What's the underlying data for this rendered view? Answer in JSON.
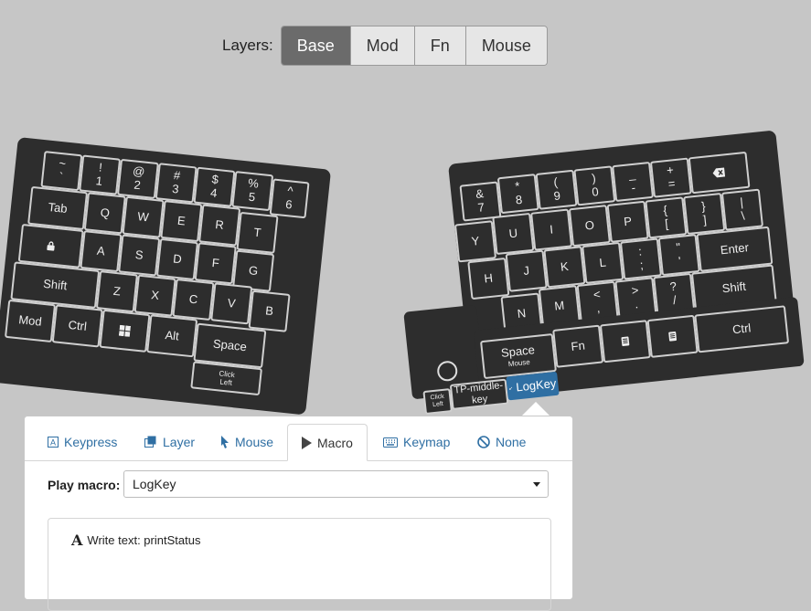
{
  "layers": {
    "label": "Layers:",
    "items": [
      {
        "label": "Base",
        "active": true
      },
      {
        "label": "Mod",
        "active": false
      },
      {
        "label": "Fn",
        "active": false
      },
      {
        "label": "Mouse",
        "active": false
      }
    ]
  },
  "left_keys": {
    "tilde": {
      "top": "~",
      "bottom": "`"
    },
    "k1": {
      "top": "!",
      "bottom": "1"
    },
    "k2": {
      "top": "@",
      "bottom": "2"
    },
    "k3": {
      "top": "#",
      "bottom": "3"
    },
    "k4": {
      "top": "$",
      "bottom": "4"
    },
    "k5": {
      "top": "%",
      "bottom": "5"
    },
    "k6": {
      "top": "^",
      "bottom": "6"
    },
    "tab": "Tab",
    "q": "Q",
    "w": "W",
    "e": "E",
    "r": "R",
    "t": "T",
    "a": "A",
    "s": "S",
    "d": "D",
    "f": "F",
    "g": "G",
    "shift": "Shift",
    "z": "Z",
    "x": "X",
    "c": "C",
    "v": "V",
    "b": "B",
    "mod": "Mod",
    "ctrl": "Ctrl",
    "alt": "Alt",
    "space": "Space",
    "click_left": {
      "top": "Click",
      "bottom": "Left"
    }
  },
  "right_keys": {
    "k7": {
      "top": "&",
      "bottom": "7"
    },
    "k8": {
      "top": "*",
      "bottom": "8"
    },
    "k9": {
      "top": "(",
      "bottom": "9"
    },
    "k0": {
      "top": ")",
      "bottom": "0"
    },
    "minus": {
      "top": "_",
      "bottom": "-"
    },
    "equal": {
      "top": "+",
      "bottom": "="
    },
    "y": "Y",
    "u": "U",
    "i": "I",
    "o": "O",
    "p": "P",
    "lbracket": {
      "top": "{",
      "bottom": "["
    },
    "rbracket": {
      "top": "}",
      "bottom": "]"
    },
    "pipe": {
      "top": "|",
      "bottom": "\\"
    },
    "h": "H",
    "j": "J",
    "k": "K",
    "l": "L",
    "semicolon": {
      "top": ":",
      "bottom": ";"
    },
    "quote": {
      "top": "\"",
      "bottom": "'"
    },
    "enter": "Enter",
    "n": "N",
    "m": "M",
    "comma": {
      "top": "<",
      "bottom": ","
    },
    "period": {
      "top": ">",
      "bottom": "."
    },
    "slash": {
      "top": "?",
      "bottom": "/"
    },
    "shift": "Shift",
    "space": "Space",
    "space_sub": "Mouse",
    "fn": "Fn",
    "ctrl": "Ctrl",
    "logkey": "LogKey",
    "click_left": {
      "top": "Click",
      "bottom": "Left"
    },
    "tp_middle": "TP-middle-key"
  },
  "panel": {
    "tabs": [
      {
        "label": "Keypress",
        "icon": "keypress-icon"
      },
      {
        "label": "Layer",
        "icon": "layer-icon"
      },
      {
        "label": "Mouse",
        "icon": "mouse-pointer-icon"
      },
      {
        "label": "Macro",
        "icon": "play-icon",
        "active": true
      },
      {
        "label": "Keymap",
        "icon": "keyboard-icon"
      },
      {
        "label": "None",
        "icon": "ban-icon"
      }
    ],
    "play_macro_label": "Play macro:",
    "selected_macro": "LogKey",
    "macro_actions": [
      {
        "label": "Write text: printStatus",
        "icon": "font-icon"
      }
    ]
  },
  "colors": {
    "keyboard": "#2d2d2d",
    "key_border": "#cfcfcf",
    "highlight": "#2f6fa3",
    "background": "#c6c6c6",
    "active_layer": "#6b6b6b"
  }
}
